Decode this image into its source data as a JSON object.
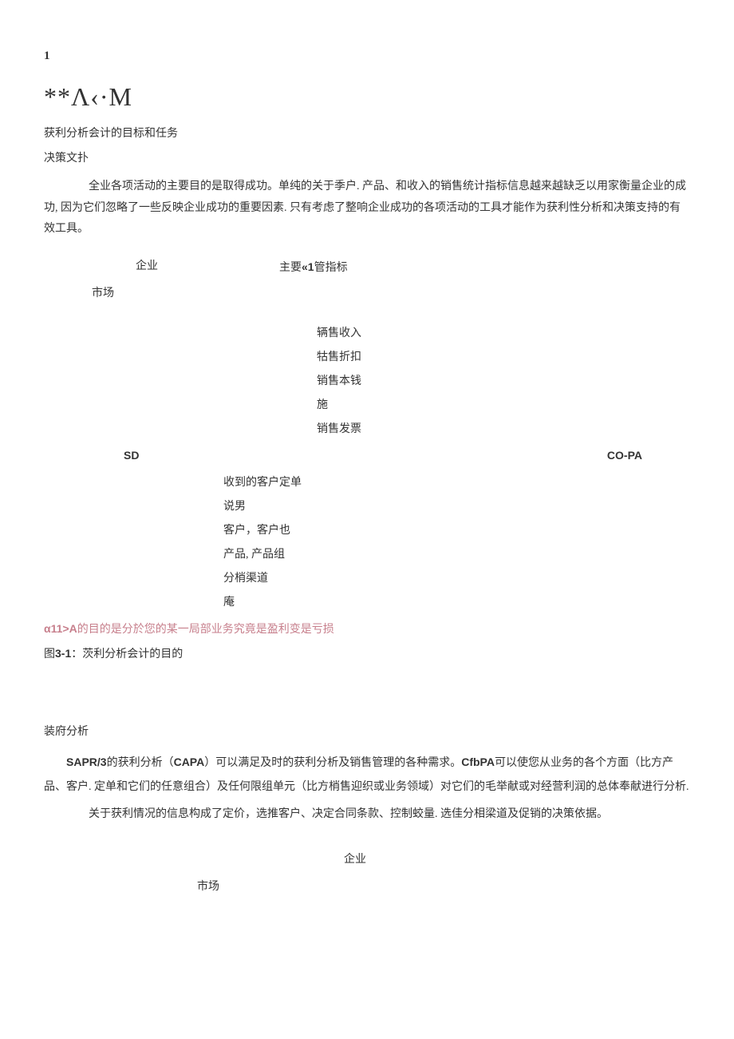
{
  "page_number": "1",
  "formula": "**Λ‹·M",
  "heading_main": "获利分析会计的目标和任务",
  "heading_sub": "决策文扑",
  "para1": "全业各项活动的主要目的是取得成功。单纯的关于季户. 产品、和收入的销售统计指标信息越来越缺乏以用家衡量企业的成功, 因为它们忽略了一些反映企业成功的重要因素. 只有考虑了整响企业成功的各项活动的工具才能作为获利性分析和决策支持的有效工具。",
  "diagram": {
    "row_top_left": "企业",
    "row_top_right_prefix": "主要",
    "row_top_right_bold": "«1",
    "row_top_right_suffix": "管指标",
    "market": "市场",
    "center_items": [
      "辆售收入",
      "牯售折扣",
      "销售本钱",
      "施",
      "销售发票"
    ],
    "mid_left": "SD",
    "mid_right": "CO-PA",
    "left_items": [
      "收到的客户定单",
      "说男",
      "客户，客户也",
      "产品, 产品组",
      "分梢渠道",
      "庵"
    ]
  },
  "pink": {
    "bold": "α11>A",
    "rest": "的目的是分於您的某一局部业务究竟是盈利变是亏损"
  },
  "caption": {
    "prefix": "图",
    "bold": "3-1",
    "suffix": "：茨利分析会计的目的"
  },
  "section2_heading": "装府分析",
  "para2_indent": "  ",
  "para2": {
    "p1_a": "SAPR/3",
    "p1_b": "的获利分析（",
    "p1_c": "CAPA",
    "p1_d": "）可以满足及时的获利分析及销售管理的各种需求。",
    "p1_e": "CfbPA",
    "p1_f": "可以使您从业务的各个方面（比方产品、客户. 定单和它们的任意组合）及任何限组单元（比方梢售迎织或业务领域）对它们的毛举献或对经营利润的总体奉献进行分析."
  },
  "para3": "关于获利情况的信息构成了定价，选推客户、决定合同条款、控制蛟量. 选佳分相梁道及促销的决策依据。",
  "bottom": {
    "center": "企业",
    "market": "市场"
  }
}
